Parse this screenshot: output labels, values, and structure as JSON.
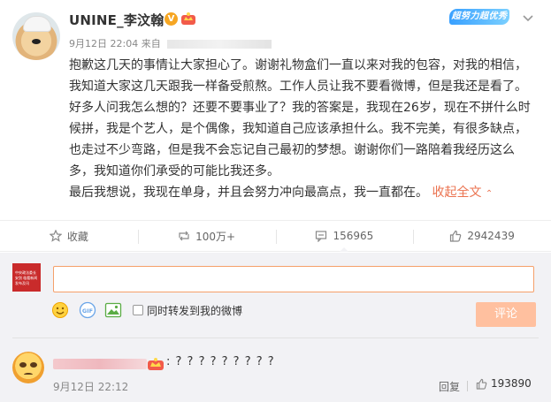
{
  "post": {
    "username": "UNINE_李汶翰",
    "verified_badge": "V",
    "topic_badge": "超努力超优秀",
    "time": "9月12日 22:04",
    "source_prefix": "来自",
    "text": "抱歉这几天的事情让大家担心了。谢谢礼物盒们一直以来对我的包容，对我的相信，我知道大家这几天跟我一样备受煎熬。工作人员让我不要看微博，但是我还是看了。好多人问我怎么想的？还要不要事业了？我的答案是，我现在26岁，现在不拼什么时候拼，我是个艺人，是个偶像，我知道自己应该承担什么。我不完美，有很多缺点，也走过不少弯路，但是我不会忘记自己最初的梦想。谢谢你们一路陪着我经历这么多，我知道你们承受的可能比我还多。",
    "text_last": "最后我想说，我现在单身，并且会努力冲向最高点，我一直都在。",
    "collapse_label": "收起全文",
    "icons": [
      "crown-icon",
      "chevron-down-icon"
    ]
  },
  "actions": [
    {
      "name": "favorite",
      "label": "收藏",
      "icon": "star-icon"
    },
    {
      "name": "repost",
      "label": "100万+",
      "icon": "repost-icon"
    },
    {
      "name": "comment",
      "label": "156965",
      "icon": "comment-icon"
    },
    {
      "name": "like",
      "label": "2942439",
      "icon": "thumbs-up-icon"
    }
  ],
  "composer": {
    "avatar_text": "中央政法委长安剑 临看新闻 发布及讯",
    "input_value": "",
    "repost_label": "同时转发到我的微博",
    "submit_label": "评论",
    "icons": [
      "emoji-icon",
      "gif-icon",
      "image-icon"
    ]
  },
  "comment": {
    "text": ": ? ? ? ? ? ? ? ? ?",
    "time": "9月12日 22:12",
    "reply_label": "回复",
    "like_count": "193890"
  },
  "colors": {
    "accent": "#eb7350",
    "input_border": "#f5a06a",
    "submit_bg": "#ffc09f",
    "panel_bg": "#f2f2f5",
    "topic_badge": "#39a0ff"
  }
}
